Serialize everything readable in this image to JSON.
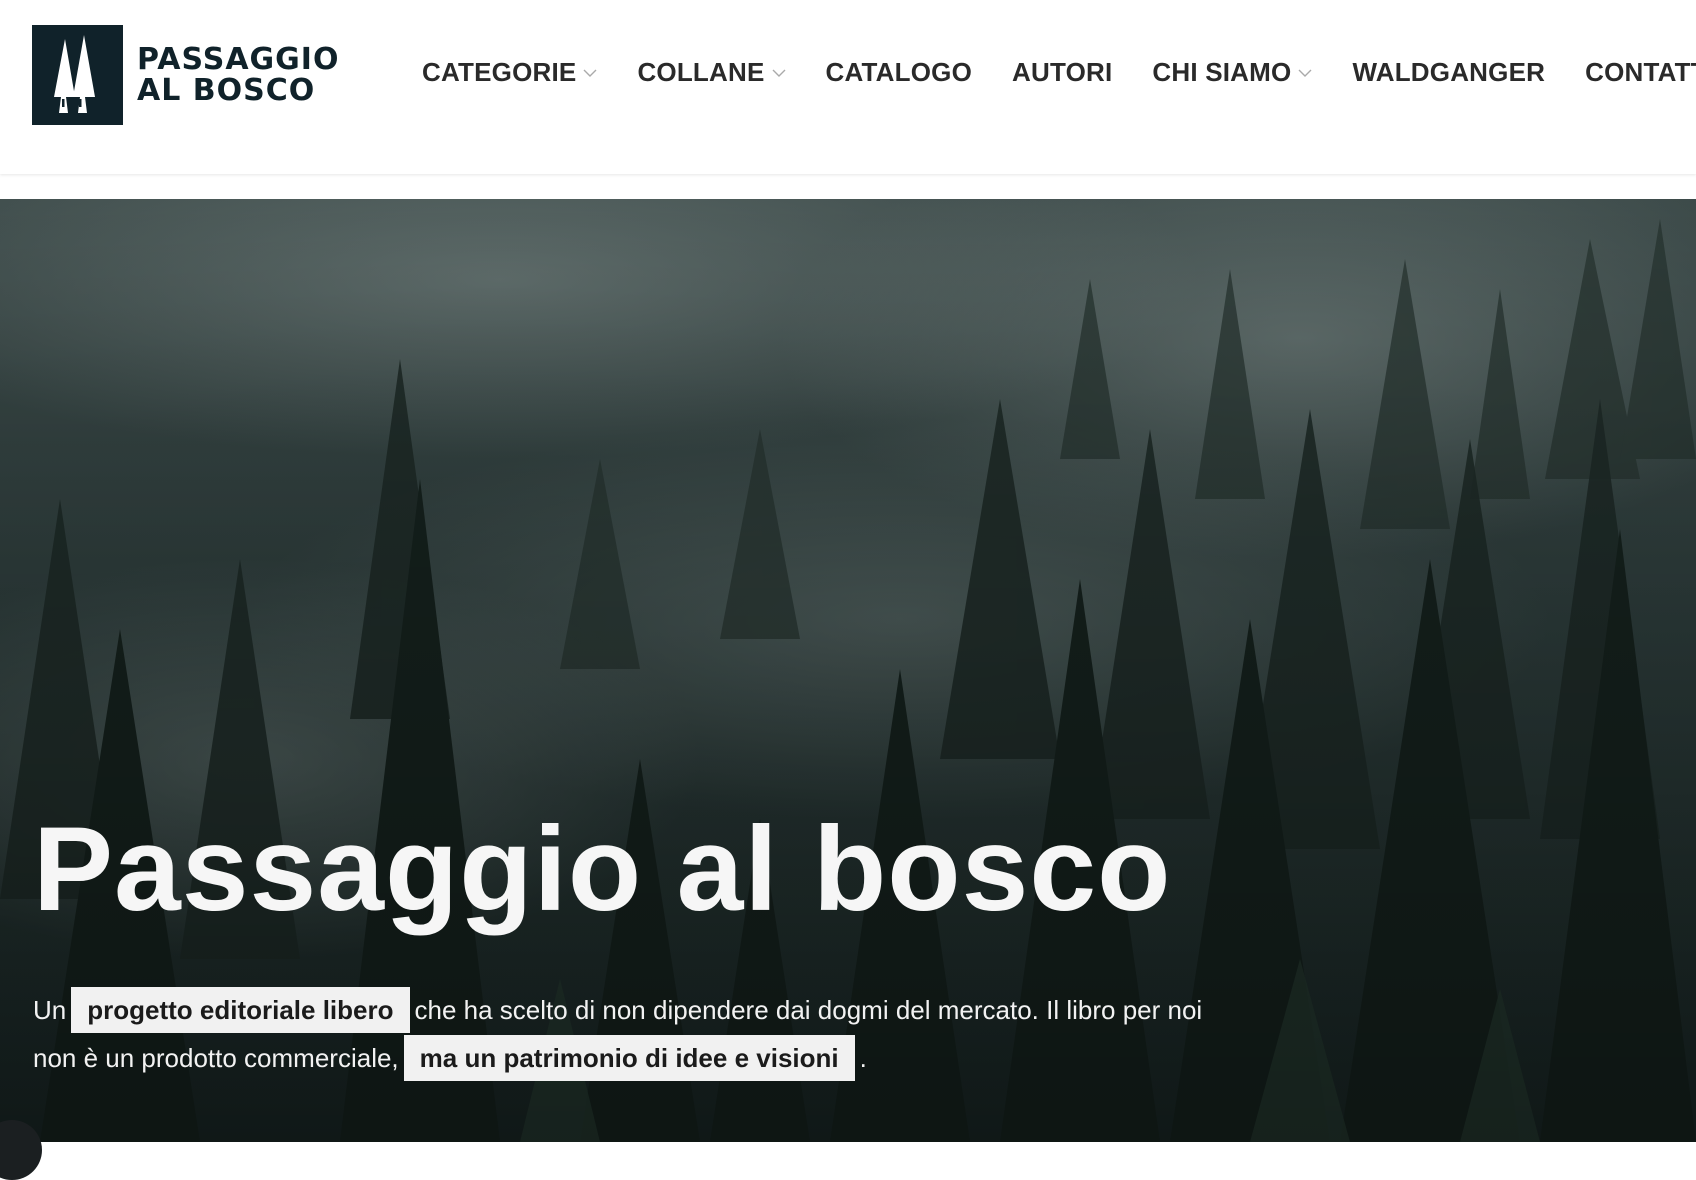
{
  "brand": {
    "line1": "PASSAGGIO",
    "line2": "AL BOSCO",
    "color": "#10222a"
  },
  "nav": {
    "items": [
      {
        "label": "CATEGORIE",
        "dropdown": true
      },
      {
        "label": "COLLANE",
        "dropdown": true
      },
      {
        "label": "CATALOGO",
        "dropdown": false
      },
      {
        "label": "AUTORI",
        "dropdown": false
      },
      {
        "label": "CHI SIAMO",
        "dropdown": true
      },
      {
        "label": "WALDGANGER",
        "dropdown": false
      },
      {
        "label": "CONTATTI",
        "dropdown": false
      }
    ]
  },
  "hero": {
    "title": "Passaggio al bosco",
    "text_pre": "Un",
    "highlight1": "progetto editoriale libero",
    "text_mid": "che ha scelto di non dipendere dai dogmi del mercato. Il libro per noi non è un prodotto commerciale,",
    "highlight2": "ma un patrimonio di idee e visioni",
    "text_post": "."
  },
  "icons": {
    "logo": "trees-logo-icon",
    "dropdown": "chevron-down-icon"
  },
  "colors": {
    "accent": "#10222a",
    "nav_text": "#2a2a2a",
    "hero_text": "#f6f6f6",
    "highlight_bg": "#f1f1f1"
  }
}
